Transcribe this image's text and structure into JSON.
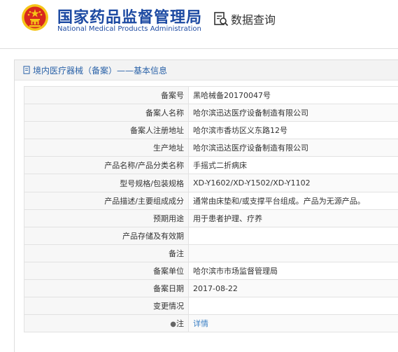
{
  "header": {
    "org_name_cn": "国家药品监督管理局",
    "org_name_en": "National Medical Products Administration",
    "query_label": "数据查询"
  },
  "panel": {
    "title": "境内医疗器械（备案）——基本信息"
  },
  "fields": {
    "record_no": {
      "label": "备案号",
      "value": "黑哈械备20170047号"
    },
    "registrant": {
      "label": "备案人名称",
      "value": "哈尔滨迅达医疗设备制造有限公司"
    },
    "registrant_addr": {
      "label": "备案人注册地址",
      "value": "哈尔滨市香坊区义东路12号"
    },
    "production_addr": {
      "label": "生产地址",
      "value": "哈尔滨迅达医疗设备制造有限公司"
    },
    "product_name": {
      "label": "产品名称/产品分类名称",
      "value": "手摇式二折病床"
    },
    "model_spec": {
      "label": "型号规格/包装规格",
      "value": "XD-Y1602/XD-Y1502/XD-Y1102"
    },
    "description": {
      "label": "产品描述/主要组成成分",
      "value": "通常由床垫和/或支撑平台组成。产品为无源产品。"
    },
    "intended_use": {
      "label": "预期用途",
      "value": "用于患者护理、疗养"
    },
    "storage": {
      "label": "产品存储及有效期",
      "value": ""
    },
    "remark": {
      "label": "备注",
      "value": ""
    },
    "record_unit": {
      "label": "备案单位",
      "value": "哈尔滨市市场监督管理局"
    },
    "record_date": {
      "label": "备案日期",
      "value": "2017-08-22"
    },
    "change_info": {
      "label": "变更情况",
      "value": ""
    },
    "note": {
      "label": "注",
      "value": "详情",
      "pin_icon": "●"
    }
  },
  "colors": {
    "brand_blue": "#1d4aa2",
    "link_blue": "#3a7fc4",
    "emblem_red": "#d8281e",
    "emblem_gold": "#f5c518"
  },
  "icons": {
    "emblem": "national-emblem",
    "query": "document-search-icon",
    "panel_title": "document-icon",
    "note_pin": "location-pin-icon"
  }
}
